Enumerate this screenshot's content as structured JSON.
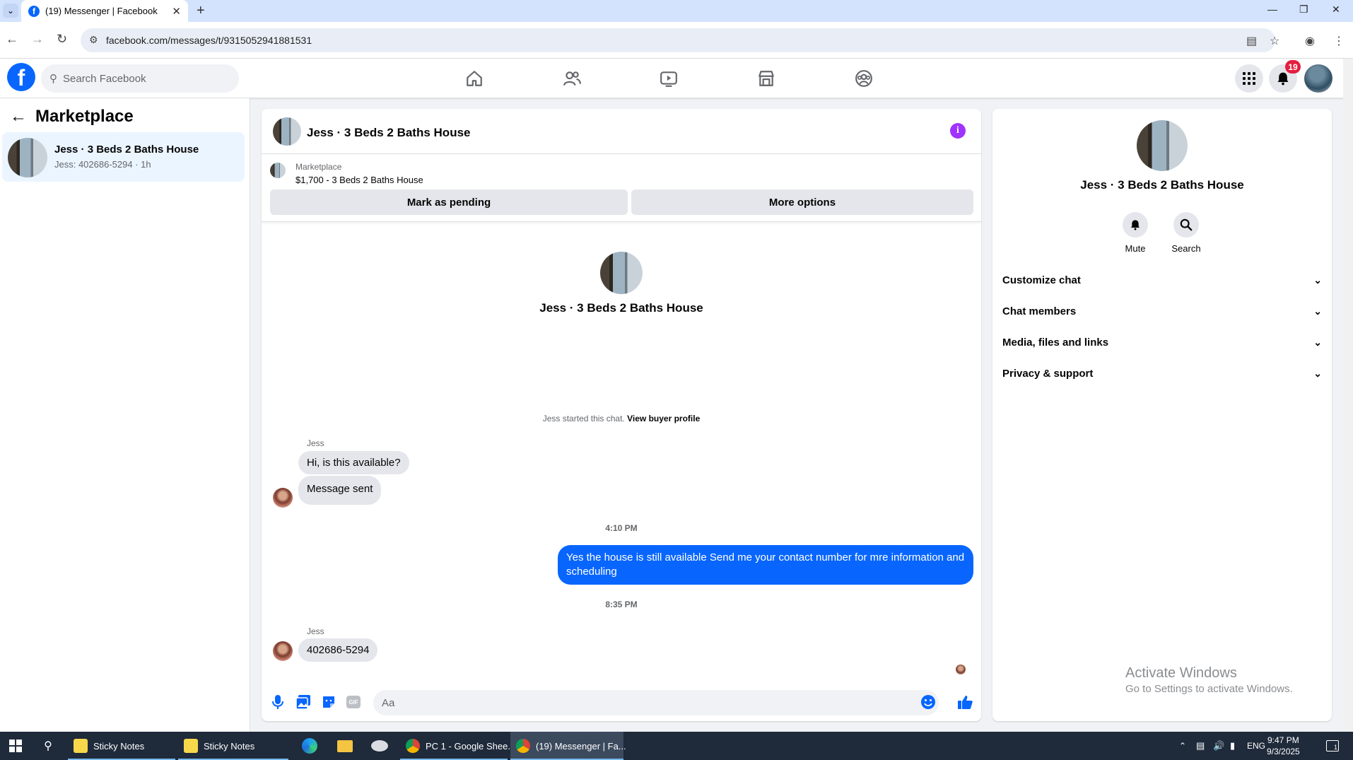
{
  "browser": {
    "tab_title": "(19) Messenger | Facebook",
    "tab_favicon": "f",
    "url": "facebook.com/messages/t/9315052941881531"
  },
  "fb": {
    "search_placeholder": "Search Facebook",
    "notification_count": "19",
    "brand_color": "#0866ff"
  },
  "left": {
    "title": "Marketplace",
    "conversation": {
      "name": "Jess · 3 Beds 2 Baths House",
      "subtitle": "Jess: 402686-5294 · 1h"
    }
  },
  "chat": {
    "title": "Jess · 3 Beds 2 Baths House",
    "info_icon": "i",
    "marketplace_label": "Marketplace",
    "listing": "$1,700 - 3 Beds 2 Baths House",
    "mark_pending": "Mark as pending",
    "more_options": "More options",
    "intro_name": "Jess · 3 Beds 2 Baths House",
    "started_text": "Jess started this chat.",
    "view_buyer": "View buyer profile",
    "messages": {
      "sender1": "Jess",
      "m1": "Hi, is this available?",
      "m2": "Message sent",
      "ts1": "4:10 PM",
      "m3": "Yes the house is still available  Send me your contact number for mre information and  scheduling",
      "ts2": "8:35 PM",
      "sender2": "Jess",
      "m4": "402686-5294"
    },
    "composer_placeholder": "Aa",
    "gif_label": "GIF"
  },
  "right": {
    "name": "Jess · 3 Beds 2 Baths House",
    "mute": "Mute",
    "search": "Search",
    "rows": [
      "Customize chat",
      "Chat members",
      "Media, files and links",
      "Privacy & support"
    ]
  },
  "watermark": {
    "line1": "Activate Windows",
    "line2": "Go to Settings to activate Windows."
  },
  "taskbar": {
    "items": [
      "Sticky Notes",
      "Sticky Notes",
      "PC 1 - Google Shee...",
      "(19) Messenger | Fa..."
    ],
    "lang": "ENG",
    "time": "9:47 PM",
    "date": "9/3/2025",
    "notif_count": "1"
  }
}
